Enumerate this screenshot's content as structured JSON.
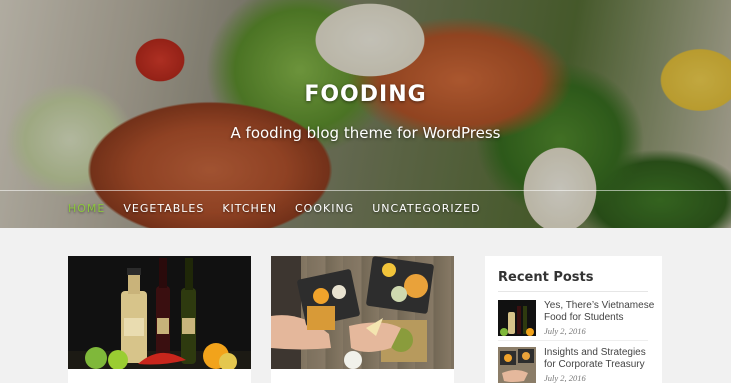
{
  "site": {
    "title": "FOODING",
    "tagline": "A fooding blog theme for WordPress"
  },
  "nav": {
    "items": [
      {
        "label": "HOME",
        "active": true
      },
      {
        "label": "VEGETABLES",
        "active": false
      },
      {
        "label": "KITCHEN",
        "active": false
      },
      {
        "label": "COOKING",
        "active": false
      },
      {
        "label": "UNCATEGORIZED",
        "active": false
      }
    ]
  },
  "sidebar": {
    "widget_title": "Recent Posts",
    "posts": [
      {
        "title": "Yes, There’s Vietnamese Food for Students",
        "date": "July 2, 2016"
      },
      {
        "title": "Insights and Strategies for Corporate Treasury",
        "date": "July 2, 2016"
      }
    ]
  },
  "colors": {
    "accent": "#8cc63f",
    "text": "#333333",
    "background": "#f1f1f1"
  }
}
